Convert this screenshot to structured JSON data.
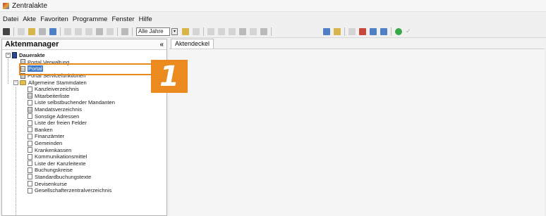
{
  "window": {
    "title": "Zentralakte"
  },
  "menu": [
    "Datei",
    "Akte",
    "Favoriten",
    "Programme",
    "Fenster",
    "Hilfe"
  ],
  "toolbar": {
    "year_select_value": "Alle Jahre",
    "dropdown_arrow": "▾"
  },
  "left_panel": {
    "title": "Aktenmanager",
    "collapse_label": "«",
    "tree": {
      "root": {
        "label": "Dauerakte",
        "toggle": "−"
      },
      "children": [
        {
          "label": "Portal Verwaltung",
          "icon": "table-icon"
        },
        {
          "label": "Portal",
          "icon": "table-icon",
          "selected": true
        },
        {
          "label": "Portal Servicefunktionen",
          "icon": "table-icon"
        },
        {
          "label": "Allgemeine Stammdaten",
          "icon": "folder-icon",
          "toggle": "−",
          "children": [
            "Kanzleiverzeichnis",
            "Mitarbeiterliste",
            "Liste selbstbuchender Mandanten",
            "Mandatsverzeichnis",
            "Sonstige Adressen",
            "Liste der freien Felder",
            "Banken",
            "Finanzämter",
            "Gemeinden",
            "Krankenkassen",
            "Kommunikationsmittel",
            "Liste der Kanzleitexte",
            "Buchungskreise",
            "Standardbuchungstexte",
            "Devisenkurse",
            "Gesellschafterzentralverzeichnis"
          ]
        }
      ]
    }
  },
  "callout": {
    "number": "1"
  },
  "right_panel": {
    "tabs": [
      "Aktendeckel"
    ]
  },
  "colors": {
    "accent": "#eb8a1e",
    "selection": "#3a78c8"
  }
}
